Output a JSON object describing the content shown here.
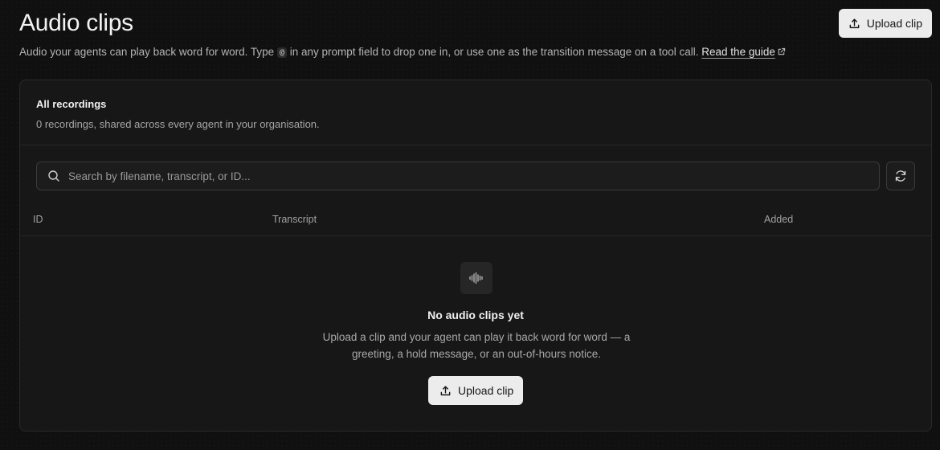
{
  "header": {
    "title": "Audio clips",
    "subtitle_before": "Audio your agents can play back word for word. Type ",
    "subtitle_code": "@",
    "subtitle_after": " in any prompt field to drop one in, or use one as the transition message on a tool call. ",
    "guide_link": "Read the guide",
    "upload_label": "Upload clip"
  },
  "card": {
    "title": "All recordings",
    "description": "0 recordings, shared across every agent in your organisation."
  },
  "search": {
    "placeholder": "Search by filename, transcript, or ID..."
  },
  "table": {
    "columns": [
      "ID",
      "Transcript",
      "Added"
    ]
  },
  "empty_state": {
    "title": "No audio clips yet",
    "description": "Upload a clip and your agent can play it back word for word — a greeting, a hold message, or an out-of-hours notice.",
    "upload_label": "Upload clip"
  },
  "icons": {
    "upload": "upload-icon",
    "external": "external-link-icon",
    "search": "search-icon",
    "refresh": "refresh-icon",
    "waveform": "waveform-icon"
  }
}
